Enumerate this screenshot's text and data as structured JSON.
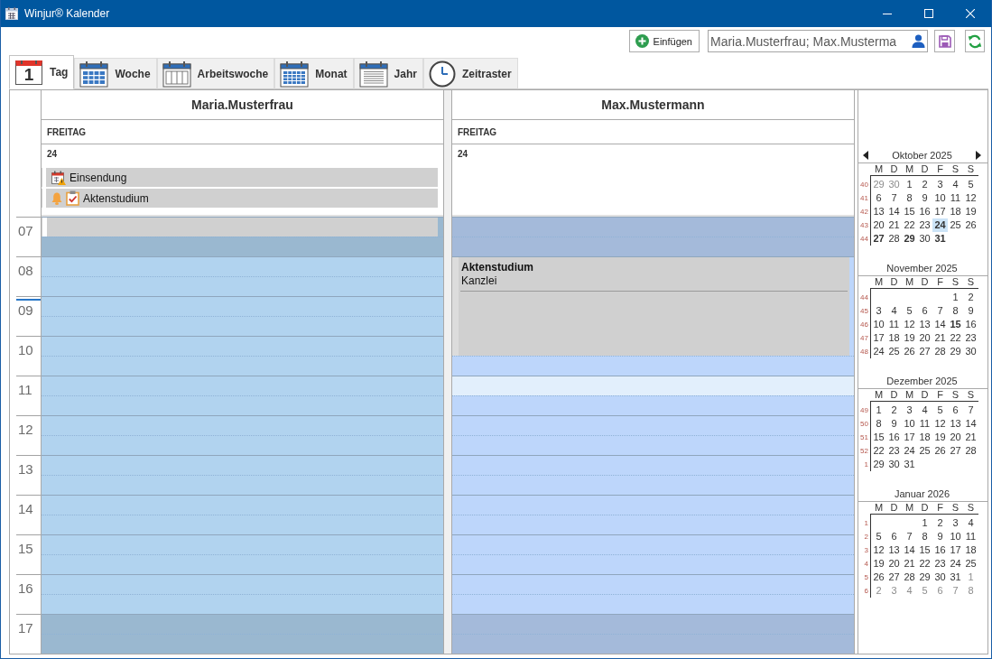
{
  "window": {
    "title": "Winjur® Kalender"
  },
  "toolbar": {
    "insert_button": "Einfügen",
    "resource_field": {
      "value": "Maria.Musterfrau; Max.Musterma"
    }
  },
  "tabs": [
    {
      "label": "Tag",
      "kind": "day",
      "icon_text": "1",
      "selected": true
    },
    {
      "label": "Woche",
      "kind": "week",
      "selected": false
    },
    {
      "label": "Arbeitswoche",
      "kind": "workweek",
      "selected": false
    },
    {
      "label": "Monat",
      "kind": "month",
      "selected": false
    },
    {
      "label": "Jahr",
      "kind": "year",
      "selected": false
    },
    {
      "label": "Zeitraster",
      "kind": "timegrid",
      "selected": false
    }
  ],
  "hours": [
    {
      "label": "07",
      "work": false,
      "now_marker": false
    },
    {
      "label": "08",
      "work": true,
      "now_marker": false
    },
    {
      "label": "09",
      "work": true,
      "now_marker": true
    },
    {
      "label": "10",
      "work": true,
      "now_marker": false
    },
    {
      "label": "11",
      "work": true,
      "now_marker": false
    },
    {
      "label": "12",
      "work": true,
      "now_marker": false
    },
    {
      "label": "13",
      "work": true,
      "now_marker": false
    },
    {
      "label": "14",
      "work": true,
      "now_marker": false
    },
    {
      "label": "15",
      "work": true,
      "now_marker": false
    },
    {
      "label": "16",
      "work": true,
      "now_marker": false
    },
    {
      "label": "17",
      "work": false,
      "now_marker": false
    }
  ],
  "columns": [
    {
      "name": "Maria.Musterfrau",
      "weekday": "FREITAG",
      "date": "24",
      "color": "#b1d3ef",
      "all_day_events": [
        {
          "title": "Einsendung",
          "kind": "deadline",
          "reminder": false
        },
        {
          "title": "Aktenstudium",
          "kind": "task",
          "reminder": true
        }
      ],
      "slots": [
        {
          "kind": "busy"
        },
        {
          "kind": "free",
          "selected": false
        },
        {
          "kind": "free",
          "selected": false
        },
        {
          "kind": "free",
          "selected": false
        },
        {
          "kind": "free",
          "selected": false
        },
        {
          "kind": "free",
          "selected": false
        },
        {
          "kind": "free",
          "selected": false
        },
        {
          "kind": "free",
          "selected": false
        },
        {
          "kind": "free",
          "selected": false
        },
        {
          "kind": "free",
          "selected": false
        },
        {
          "kind": "free",
          "selected": false
        },
        {
          "kind": "free",
          "selected": false
        },
        {
          "kind": "free",
          "selected": false
        },
        {
          "kind": "free",
          "selected": false
        },
        {
          "kind": "free",
          "selected": false
        },
        {
          "kind": "free",
          "selected": false
        },
        {
          "kind": "free",
          "selected": false
        },
        {
          "kind": "free",
          "selected": false
        },
        {
          "kind": "free",
          "selected": false
        },
        {
          "kind": "free",
          "selected": false
        },
        {
          "kind": "free",
          "selected": false
        },
        {
          "kind": "free",
          "selected": false
        }
      ],
      "timed_events": [
        {
          "kind": "plain"
        }
      ]
    },
    {
      "name": "Max.Mustermann",
      "weekday": "FREITAG",
      "date": "24",
      "color": "#bdd6fb",
      "slots": [
        {
          "kind": "free",
          "selected": false
        },
        {
          "kind": "free",
          "selected": false
        },
        {
          "kind": "busy"
        },
        {
          "kind": "busy"
        },
        {
          "kind": "busy"
        },
        {
          "kind": "busy"
        },
        {
          "kind": "busy"
        },
        {
          "kind": "free",
          "selected": false
        },
        {
          "kind": "free",
          "selected": true
        },
        {
          "kind": "free",
          "selected": false
        },
        {
          "kind": "free",
          "selected": false
        },
        {
          "kind": "free",
          "selected": false
        },
        {
          "kind": "free",
          "selected": false
        },
        {
          "kind": "free",
          "selected": false
        },
        {
          "kind": "free",
          "selected": false
        },
        {
          "kind": "free",
          "selected": false
        },
        {
          "kind": "free",
          "selected": false
        },
        {
          "kind": "free",
          "selected": false
        },
        {
          "kind": "free",
          "selected": false
        },
        {
          "kind": "free",
          "selected": false
        },
        {
          "kind": "free",
          "selected": false
        },
        {
          "kind": "free",
          "selected": false
        }
      ],
      "timed_events": [
        {
          "kind": "detailed",
          "title": "Aktenstudium",
          "location": "Kanzlei"
        }
      ]
    }
  ],
  "mini_calendars": [
    {
      "title": "Oktober 2025",
      "navigation": true,
      "weekdays": [
        "M",
        "D",
        "M",
        "D",
        "F",
        "S",
        "S"
      ],
      "weeks": [
        {
          "number": "40",
          "days": [
            {
              "label": "29",
              "outside": true,
              "bold": false,
              "selected": false
            },
            {
              "label": "30",
              "outside": true,
              "bold": false,
              "selected": false
            },
            {
              "label": "1",
              "outside": false,
              "bold": false,
              "selected": false
            },
            {
              "label": "2",
              "outside": false,
              "bold": false,
              "selected": false
            },
            {
              "label": "3",
              "outside": false,
              "bold": false,
              "selected": false
            },
            {
              "label": "4",
              "outside": false,
              "bold": false,
              "selected": false
            },
            {
              "label": "5",
              "outside": false,
              "bold": false,
              "selected": false
            }
          ]
        },
        {
          "number": "41",
          "days": [
            {
              "label": "6",
              "outside": false,
              "bold": false,
              "selected": false
            },
            {
              "label": "7",
              "outside": false,
              "bold": false,
              "selected": false
            },
            {
              "label": "8",
              "outside": false,
              "bold": false,
              "selected": false
            },
            {
              "label": "9",
              "outside": false,
              "bold": false,
              "selected": false
            },
            {
              "label": "10",
              "outside": false,
              "bold": false,
              "selected": false
            },
            {
              "label": "11",
              "outside": false,
              "bold": false,
              "selected": false
            },
            {
              "label": "12",
              "outside": false,
              "bold": false,
              "selected": false
            }
          ]
        },
        {
          "number": "42",
          "days": [
            {
              "label": "13",
              "outside": false,
              "bold": false,
              "selected": false
            },
            {
              "label": "14",
              "outside": false,
              "bold": false,
              "selected": false
            },
            {
              "label": "15",
              "outside": false,
              "bold": false,
              "selected": false
            },
            {
              "label": "16",
              "outside": false,
              "bold": false,
              "selected": false
            },
            {
              "label": "17",
              "outside": false,
              "bold": false,
              "selected": false
            },
            {
              "label": "18",
              "outside": false,
              "bold": false,
              "selected": false
            },
            {
              "label": "19",
              "outside": false,
              "bold": false,
              "selected": false
            }
          ]
        },
        {
          "number": "43",
          "days": [
            {
              "label": "20",
              "outside": false,
              "bold": false,
              "selected": false
            },
            {
              "label": "21",
              "outside": false,
              "bold": false,
              "selected": false
            },
            {
              "label": "22",
              "outside": false,
              "bold": false,
              "selected": false
            },
            {
              "label": "23",
              "outside": false,
              "bold": false,
              "selected": false
            },
            {
              "label": "24",
              "outside": false,
              "bold": true,
              "selected": true
            },
            {
              "label": "25",
              "outside": false,
              "bold": false,
              "selected": false
            },
            {
              "label": "26",
              "outside": false,
              "bold": false,
              "selected": false
            }
          ]
        },
        {
          "number": "44",
          "days": [
            {
              "label": "27",
              "outside": false,
              "bold": true,
              "selected": false
            },
            {
              "label": "28",
              "outside": false,
              "bold": false,
              "selected": false
            },
            {
              "label": "29",
              "outside": false,
              "bold": true,
              "selected": false
            },
            {
              "label": "30",
              "outside": false,
              "bold": false,
              "selected": false
            },
            {
              "label": "31",
              "outside": false,
              "bold": true,
              "selected": false
            }
          ]
        }
      ]
    },
    {
      "title": "November 2025",
      "navigation": false,
      "weekdays": [
        "M",
        "D",
        "M",
        "D",
        "F",
        "S",
        "S"
      ],
      "weeks": [
        {
          "number": "44",
          "days": [
            {
              "label": "1",
              "outside": false,
              "bold": false,
              "selected": false
            },
            {
              "label": "2",
              "outside": false,
              "bold": false,
              "selected": false
            }
          ]
        },
        {
          "number": "45",
          "days": [
            {
              "label": "3",
              "outside": false,
              "bold": false,
              "selected": false
            },
            {
              "label": "4",
              "outside": false,
              "bold": false,
              "selected": false
            },
            {
              "label": "5",
              "outside": false,
              "bold": false,
              "selected": false
            },
            {
              "label": "6",
              "outside": false,
              "bold": false,
              "selected": false
            },
            {
              "label": "7",
              "outside": false,
              "bold": false,
              "selected": false
            },
            {
              "label": "8",
              "outside": false,
              "bold": false,
              "selected": false
            },
            {
              "label": "9",
              "outside": false,
              "bold": false,
              "selected": false
            }
          ]
        },
        {
          "number": "46",
          "days": [
            {
              "label": "10",
              "outside": false,
              "bold": false,
              "selected": false
            },
            {
              "label": "11",
              "outside": false,
              "bold": false,
              "selected": false
            },
            {
              "label": "12",
              "outside": false,
              "bold": false,
              "selected": false
            },
            {
              "label": "13",
              "outside": false,
              "bold": false,
              "selected": false
            },
            {
              "label": "14",
              "outside": false,
              "bold": false,
              "selected": false
            },
            {
              "label": "15",
              "outside": false,
              "bold": true,
              "selected": false
            },
            {
              "label": "16",
              "outside": false,
              "bold": false,
              "selected": false
            }
          ]
        },
        {
          "number": "47",
          "days": [
            {
              "label": "17",
              "outside": false,
              "bold": false,
              "selected": false
            },
            {
              "label": "18",
              "outside": false,
              "bold": false,
              "selected": false
            },
            {
              "label": "19",
              "outside": false,
              "bold": false,
              "selected": false
            },
            {
              "label": "20",
              "outside": false,
              "bold": false,
              "selected": false
            },
            {
              "label": "21",
              "outside": false,
              "bold": false,
              "selected": false
            },
            {
              "label": "22",
              "outside": false,
              "bold": false,
              "selected": false
            },
            {
              "label": "23",
              "outside": false,
              "bold": false,
              "selected": false
            }
          ]
        },
        {
          "number": "48",
          "days": [
            {
              "label": "24",
              "outside": false,
              "bold": false,
              "selected": false
            },
            {
              "label": "25",
              "outside": false,
              "bold": false,
              "selected": false
            },
            {
              "label": "26",
              "outside": false,
              "bold": false,
              "selected": false
            },
            {
              "label": "27",
              "outside": false,
              "bold": false,
              "selected": false
            },
            {
              "label": "28",
              "outside": false,
              "bold": false,
              "selected": false
            },
            {
              "label": "29",
              "outside": false,
              "bold": false,
              "selected": false
            },
            {
              "label": "30",
              "outside": false,
              "bold": false,
              "selected": false
            }
          ]
        }
      ]
    },
    {
      "title": "Dezember 2025",
      "navigation": false,
      "weekdays": [
        "M",
        "D",
        "M",
        "D",
        "F",
        "S",
        "S"
      ],
      "weeks": [
        {
          "number": "49",
          "days": [
            {
              "label": "1",
              "outside": false,
              "bold": false,
              "selected": false
            },
            {
              "label": "2",
              "outside": false,
              "bold": false,
              "selected": false
            },
            {
              "label": "3",
              "outside": false,
              "bold": false,
              "selected": false
            },
            {
              "label": "4",
              "outside": false,
              "bold": false,
              "selected": false
            },
            {
              "label": "5",
              "outside": false,
              "bold": false,
              "selected": false
            },
            {
              "label": "6",
              "outside": false,
              "bold": false,
              "selected": false
            },
            {
              "label": "7",
              "outside": false,
              "bold": false,
              "selected": false
            }
          ]
        },
        {
          "number": "50",
          "days": [
            {
              "label": "8",
              "outside": false,
              "bold": false,
              "selected": false
            },
            {
              "label": "9",
              "outside": false,
              "bold": false,
              "selected": false
            },
            {
              "label": "10",
              "outside": false,
              "bold": false,
              "selected": false
            },
            {
              "label": "11",
              "outside": false,
              "bold": false,
              "selected": false
            },
            {
              "label": "12",
              "outside": false,
              "bold": false,
              "selected": false
            },
            {
              "label": "13",
              "outside": false,
              "bold": false,
              "selected": false
            },
            {
              "label": "14",
              "outside": false,
              "bold": false,
              "selected": false
            }
          ]
        },
        {
          "number": "51",
          "days": [
            {
              "label": "15",
              "outside": false,
              "bold": false,
              "selected": false
            },
            {
              "label": "16",
              "outside": false,
              "bold": false,
              "selected": false
            },
            {
              "label": "17",
              "outside": false,
              "bold": false,
              "selected": false
            },
            {
              "label": "18",
              "outside": false,
              "bold": false,
              "selected": false
            },
            {
              "label": "19",
              "outside": false,
              "bold": false,
              "selected": false
            },
            {
              "label": "20",
              "outside": false,
              "bold": false,
              "selected": false
            },
            {
              "label": "21",
              "outside": false,
              "bold": false,
              "selected": false
            }
          ]
        },
        {
          "number": "52",
          "days": [
            {
              "label": "22",
              "outside": false,
              "bold": false,
              "selected": false
            },
            {
              "label": "23",
              "outside": false,
              "bold": false,
              "selected": false
            },
            {
              "label": "24",
              "outside": false,
              "bold": false,
              "selected": false
            },
            {
              "label": "25",
              "outside": false,
              "bold": false,
              "selected": false
            },
            {
              "label": "26",
              "outside": false,
              "bold": false,
              "selected": false
            },
            {
              "label": "27",
              "outside": false,
              "bold": false,
              "selected": false
            },
            {
              "label": "28",
              "outside": false,
              "bold": false,
              "selected": false
            }
          ]
        },
        {
          "number": "1",
          "days": [
            {
              "label": "29",
              "outside": false,
              "bold": false,
              "selected": false
            },
            {
              "label": "30",
              "outside": false,
              "bold": false,
              "selected": false
            },
            {
              "label": "31",
              "outside": false,
              "bold": false,
              "selected": false
            }
          ]
        }
      ]
    },
    {
      "title": "Januar 2026",
      "navigation": false,
      "weekdays": [
        "M",
        "D",
        "M",
        "D",
        "F",
        "S",
        "S"
      ],
      "weeks": [
        {
          "number": "1",
          "days": [
            {
              "label": "1",
              "outside": false,
              "bold": false,
              "selected": false
            },
            {
              "label": "2",
              "outside": false,
              "bold": false,
              "selected": false
            },
            {
              "label": "3",
              "outside": false,
              "bold": false,
              "selected": false
            },
            {
              "label": "4",
              "outside": false,
              "bold": false,
              "selected": false
            }
          ]
        },
        {
          "number": "2",
          "days": [
            {
              "label": "5",
              "outside": false,
              "bold": false,
              "selected": false
            },
            {
              "label": "6",
              "outside": false,
              "bold": false,
              "selected": false
            },
            {
              "label": "7",
              "outside": false,
              "bold": false,
              "selected": false
            },
            {
              "label": "8",
              "outside": false,
              "bold": false,
              "selected": false
            },
            {
              "label": "9",
              "outside": false,
              "bold": false,
              "selected": false
            },
            {
              "label": "10",
              "outside": false,
              "bold": false,
              "selected": false
            },
            {
              "label": "11",
              "outside": false,
              "bold": false,
              "selected": false
            }
          ]
        },
        {
          "number": "3",
          "days": [
            {
              "label": "12",
              "outside": false,
              "bold": false,
              "selected": false
            },
            {
              "label": "13",
              "outside": false,
              "bold": false,
              "selected": false
            },
            {
              "label": "14",
              "outside": false,
              "bold": false,
              "selected": false
            },
            {
              "label": "15",
              "outside": false,
              "bold": false,
              "selected": false
            },
            {
              "label": "16",
              "outside": false,
              "bold": false,
              "selected": false
            },
            {
              "label": "17",
              "outside": false,
              "bold": false,
              "selected": false
            },
            {
              "label": "18",
              "outside": false,
              "bold": false,
              "selected": false
            }
          ]
        },
        {
          "number": "4",
          "days": [
            {
              "label": "19",
              "outside": false,
              "bold": false,
              "selected": false
            },
            {
              "label": "20",
              "outside": false,
              "bold": false,
              "selected": false
            },
            {
              "label": "21",
              "outside": false,
              "bold": false,
              "selected": false
            },
            {
              "label": "22",
              "outside": false,
              "bold": false,
              "selected": false
            },
            {
              "label": "23",
              "outside": false,
              "bold": false,
              "selected": false
            },
            {
              "label": "24",
              "outside": false,
              "bold": false,
              "selected": false
            },
            {
              "label": "25",
              "outside": false,
              "bold": false,
              "selected": false
            }
          ]
        },
        {
          "number": "5",
          "days": [
            {
              "label": "26",
              "outside": false,
              "bold": false,
              "selected": false
            },
            {
              "label": "27",
              "outside": false,
              "bold": false,
              "selected": false
            },
            {
              "label": "28",
              "outside": false,
              "bold": false,
              "selected": false
            },
            {
              "label": "29",
              "outside": false,
              "bold": false,
              "selected": false
            },
            {
              "label": "30",
              "outside": false,
              "bold": false,
              "selected": false
            },
            {
              "label": "31",
              "outside": false,
              "bold": false,
              "selected": false
            },
            {
              "label": "1",
              "outside": true,
              "bold": false,
              "selected": false
            }
          ]
        },
        {
          "number": "6",
          "days": [
            {
              "label": "2",
              "outside": true,
              "bold": false,
              "selected": false
            },
            {
              "label": "3",
              "outside": true,
              "bold": false,
              "selected": false
            },
            {
              "label": "4",
              "outside": true,
              "bold": false,
              "selected": false
            },
            {
              "label": "5",
              "outside": true,
              "bold": false,
              "selected": false
            },
            {
              "label": "6",
              "outside": true,
              "bold": false,
              "selected": false
            },
            {
              "label": "7",
              "outside": true,
              "bold": false,
              "selected": false
            },
            {
              "label": "8",
              "outside": true,
              "bold": false,
              "selected": false
            }
          ]
        }
      ]
    }
  ]
}
